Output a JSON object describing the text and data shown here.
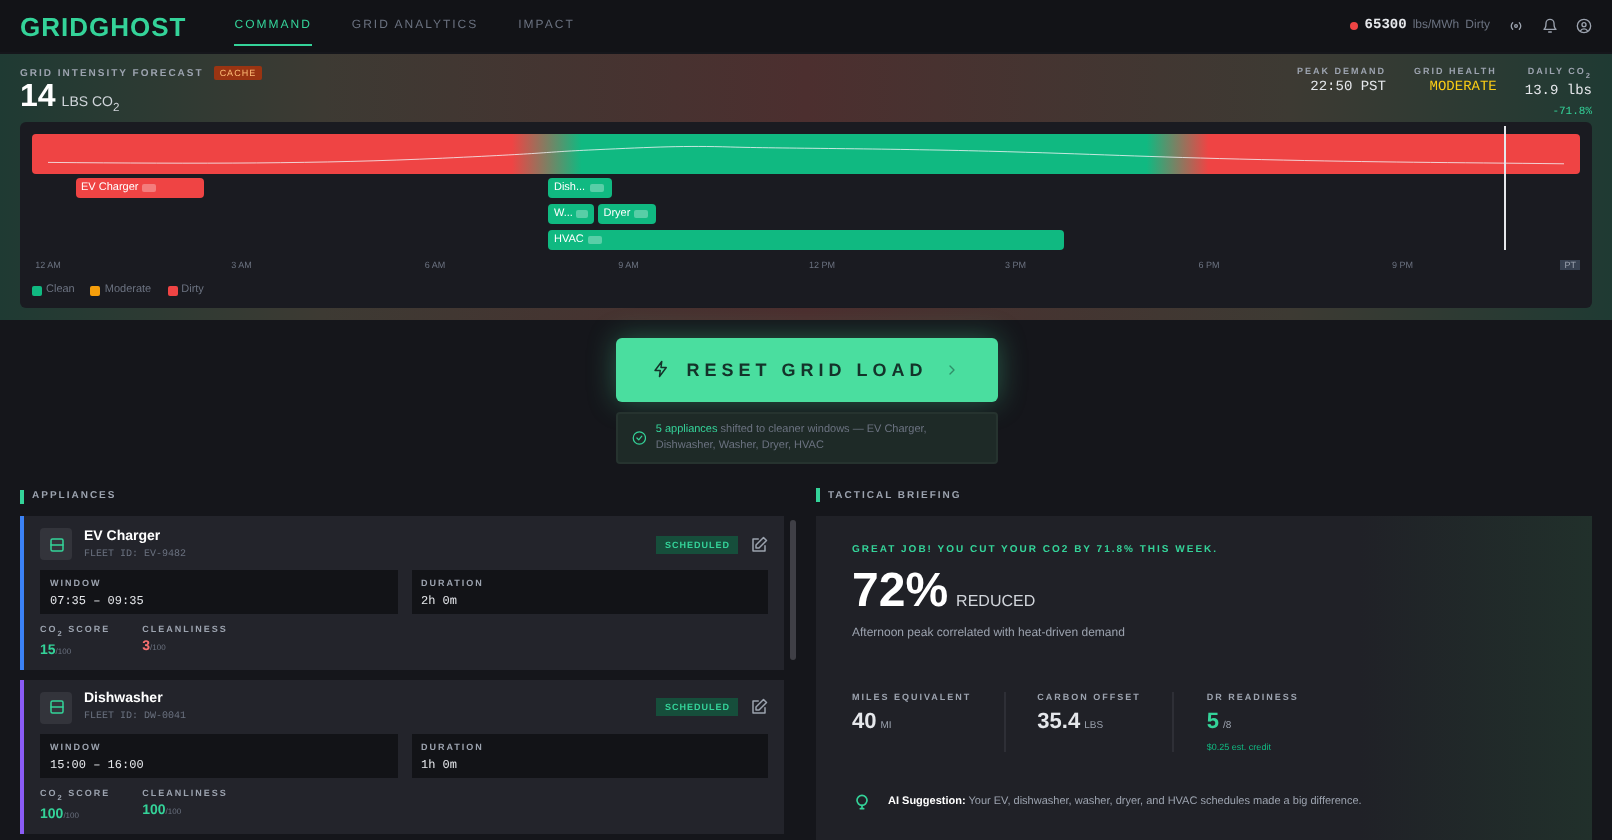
{
  "header": {
    "logo": "GRIDGHOST",
    "tabs": [
      {
        "label": "COMMAND",
        "selected": true
      },
      {
        "label": "GRID ANALYTICS",
        "selected": false
      },
      {
        "label": "IMPACT",
        "selected": false
      }
    ],
    "intensity": {
      "value": "65300",
      "unit": "lbs/MWh",
      "status": "Dirty",
      "color": "#ef4444"
    }
  },
  "forecast": {
    "title": "GRID INTENSITY FORECAST",
    "badge": "CACHE",
    "value": "14",
    "unit": "LBS CO$_{2}$",
    "stats": [
      {
        "label": "PEAK DEMAND",
        "value": "22:50 PST",
        "kind": "plain"
      },
      {
        "label": "GRID HEALTH",
        "value": "MODERATE",
        "kind": "warn"
      },
      {
        "label": "DAILY CO$_{2}$",
        "value": "13.9 lbs",
        "delta": "-71.8%",
        "kind": "plain"
      }
    ],
    "lanes": [
      [
        {
          "label": "EV Charger",
          "color": "#ef4444"
        },
        {
          "label": "Dish...",
          "color": "#10b981"
        }
      ],
      [
        {
          "label": "W...",
          "color": "#10b981"
        },
        {
          "label": "Dryer",
          "color": "#10b981"
        }
      ],
      [
        {
          "label": "HVAC",
          "color": "#10b981"
        }
      ]
    ],
    "ticks": [
      "12 AM",
      "3 AM",
      "6 AM",
      "9 AM",
      "12 PM",
      "3 PM",
      "6 PM",
      "9 PM"
    ],
    "zone": "PT",
    "legend": [
      {
        "label": "Clean",
        "color": "#10b981"
      },
      {
        "label": "Moderate",
        "color": "#f59e0b"
      },
      {
        "label": "Dirty",
        "color": "#ef4444"
      }
    ]
  },
  "action": {
    "button": "RESET GRID LOAD",
    "highlight": "5 appliances",
    "message": "shifted to cleaner windows — EV Charger, Dishwasher, Washer, Dryer, HVAC"
  },
  "appliances": {
    "title": "APPLIANCES",
    "items": [
      {
        "name": "EV Charger",
        "fleet_id": "FLEET ID: EV-9482",
        "status": "SCHEDULED",
        "color": "#3b82f6",
        "window_label": "WINDOW",
        "window": "07:35 – 09:35",
        "duration_label": "DURATION",
        "duration": "2h 0m",
        "scores": [
          {
            "label": "CO$_{2}$ SCORE",
            "value": "15",
            "max": "/100",
            "kind": "good"
          },
          {
            "label": "CLEANLINESS",
            "value": "3",
            "max": "/100",
            "kind": "bad"
          }
        ]
      },
      {
        "name": "Dishwasher",
        "fleet_id": "FLEET ID: DW-0041",
        "status": "SCHEDULED",
        "color": "#8b5cf6",
        "window_label": "WINDOW",
        "window": "15:00 – 16:00",
        "duration_label": "DURATION",
        "duration": "1h 0m",
        "scores": [
          {
            "label": "CO$_{2}$ SCORE",
            "value": "100",
            "max": "/100",
            "kind": "good"
          },
          {
            "label": "CLEANLINESS",
            "value": "100",
            "max": "/100",
            "kind": "good"
          }
        ]
      }
    ]
  },
  "briefing": {
    "title": "TACTICAL BRIEFING",
    "headline": "GREAT JOB! YOU CUT YOUR CO2 BY 71.8% THIS WEEK.",
    "big": "72%",
    "big_unit": "REDUCED",
    "note": "Afternoon peak correlated with heat-driven demand",
    "metrics": [
      {
        "label": "MILES EQUIVALENT",
        "value": "40",
        "unit": "MI",
        "kind": "plain"
      },
      {
        "label": "CARBON OFFSET",
        "value": "35.4",
        "unit": "LBS",
        "kind": "plain"
      },
      {
        "label": "DR READINESS",
        "value": "5",
        "unit": "/8",
        "sub": "$0.25 est. credit",
        "kind": "good"
      }
    ],
    "suggestion": "**AI Suggestion:** Your EV, dishwasher, washer, dryer, and HVAC schedules made a big difference."
  }
}
